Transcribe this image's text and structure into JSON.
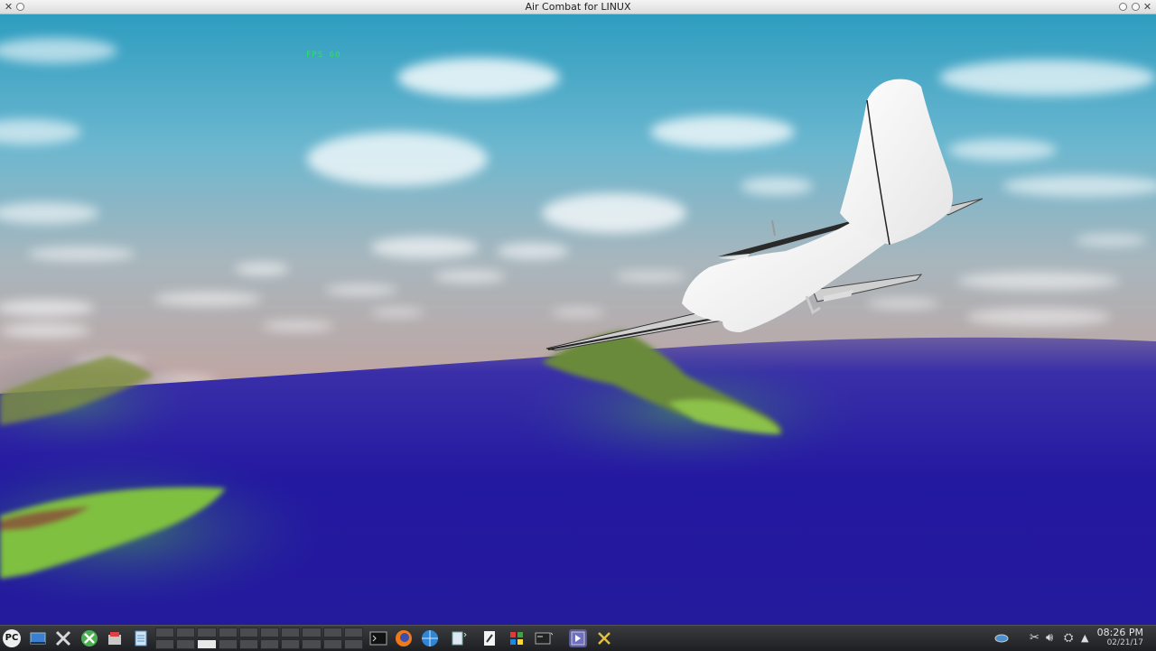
{
  "window": {
    "title": "Air Combat for LINUX"
  },
  "hud": {
    "fps_text": "FPS 60"
  },
  "taskbar": {
    "start_label": "PC",
    "clock": {
      "time": "08:26 PM",
      "date": "02/21/17"
    }
  }
}
